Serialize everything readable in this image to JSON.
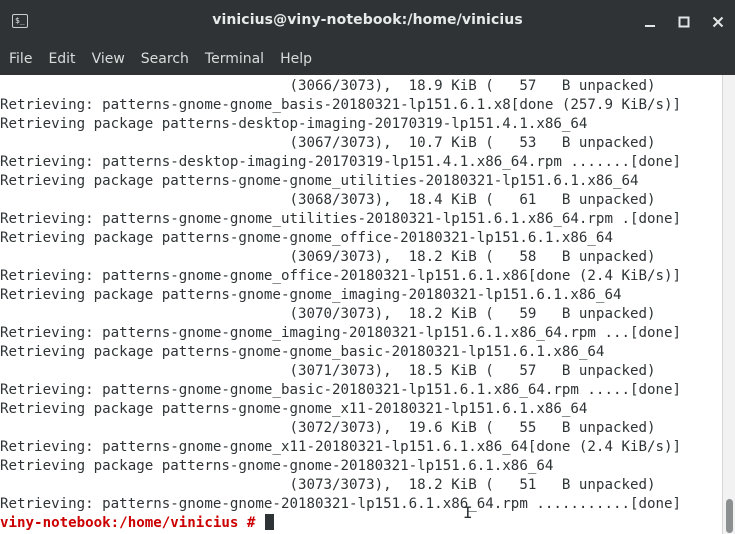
{
  "window": {
    "title": "vinicius@viny-notebook:/home/vinicius",
    "icon": "terminal-icon",
    "controls": {
      "minimize": "–",
      "maximize": "□",
      "close": "✕"
    }
  },
  "menu": [
    "File",
    "Edit",
    "View",
    "Search",
    "Terminal",
    "Help"
  ],
  "terminal": {
    "lines": [
      "                                  (3066/3073),  18.9 KiB (   57   B unpacked)",
      "Retrieving: patterns-gnome-gnome_basis-20180321-lp151.6.1.x8[done (257.9 KiB/s)]",
      "Retrieving package patterns-desktop-imaging-20170319-lp151.4.1.x86_64",
      "                                  (3067/3073),  10.7 KiB (   53   B unpacked)",
      "Retrieving: patterns-desktop-imaging-20170319-lp151.4.1.x86_64.rpm .......[done]",
      "Retrieving package patterns-gnome-gnome_utilities-20180321-lp151.6.1.x86_64",
      "                                  (3068/3073),  18.4 KiB (   61   B unpacked)",
      "Retrieving: patterns-gnome-gnome_utilities-20180321-lp151.6.1.x86_64.rpm .[done]",
      "Retrieving package patterns-gnome-gnome_office-20180321-lp151.6.1.x86_64",
      "                                  (3069/3073),  18.2 KiB (   58   B unpacked)",
      "Retrieving: patterns-gnome-gnome_office-20180321-lp151.6.1.x86[done (2.4 KiB/s)]",
      "Retrieving package patterns-gnome-gnome_imaging-20180321-lp151.6.1.x86_64",
      "                                  (3070/3073),  18.2 KiB (   59   B unpacked)",
      "Retrieving: patterns-gnome-gnome_imaging-20180321-lp151.6.1.x86_64.rpm ...[done]",
      "Retrieving package patterns-gnome-gnome_basic-20180321-lp151.6.1.x86_64",
      "                                  (3071/3073),  18.5 KiB (   57   B unpacked)",
      "Retrieving: patterns-gnome-gnome_basic-20180321-lp151.6.1.x86_64.rpm .....[done]",
      "Retrieving package patterns-gnome-gnome_x11-20180321-lp151.6.1.x86_64",
      "                                  (3072/3073),  19.6 KiB (   55   B unpacked)",
      "Retrieving: patterns-gnome-gnome_x11-20180321-lp151.6.1.x86_64[done (2.4 KiB/s)]",
      "Retrieving package patterns-gnome-gnome-20180321-lp151.6.1.x86_64",
      "                                  (3073/3073),  18.2 KiB (   51   B unpacked)",
      "Retrieving: patterns-gnome-gnome-20180321-lp151.6.1.x86_64.rpm ...........[done]"
    ],
    "prompt": "viny-notebook:/home/vinicius #",
    "input": " "
  },
  "colors": {
    "titlebar": "#2f3335",
    "terminal_bg": "#ffffff",
    "terminal_fg": "#2e3436",
    "prompt": "#cc0000"
  }
}
